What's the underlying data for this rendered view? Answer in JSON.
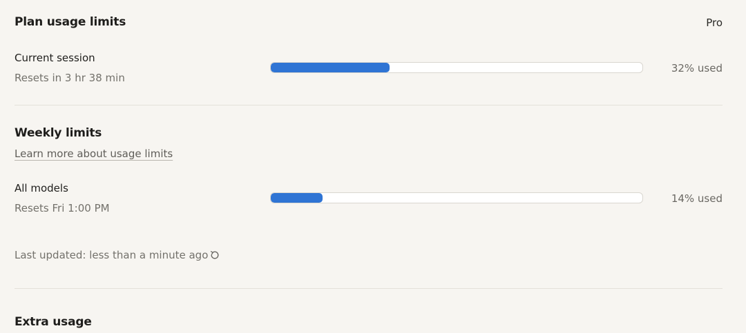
{
  "plan": {
    "title": "Plan usage limits",
    "tier": "Pro"
  },
  "session": {
    "label": "Current session",
    "reset": "Resets in 3 hr 38 min",
    "progress": 0.32,
    "used_text": "32% used"
  },
  "weekly": {
    "title": "Weekly limits",
    "learn_more": "Learn more about usage limits",
    "all_models": {
      "label": "All models",
      "reset": "Resets Fri 1:00 PM",
      "progress": 0.14,
      "used_text": "14% used"
    },
    "last_updated": "Last updated: less than a minute ago",
    "refresh_icon": "refresh-icon"
  },
  "extra": {
    "title": "Extra usage"
  },
  "colors": {
    "accent": "#2f74d4",
    "background": "#f7f5f1"
  }
}
